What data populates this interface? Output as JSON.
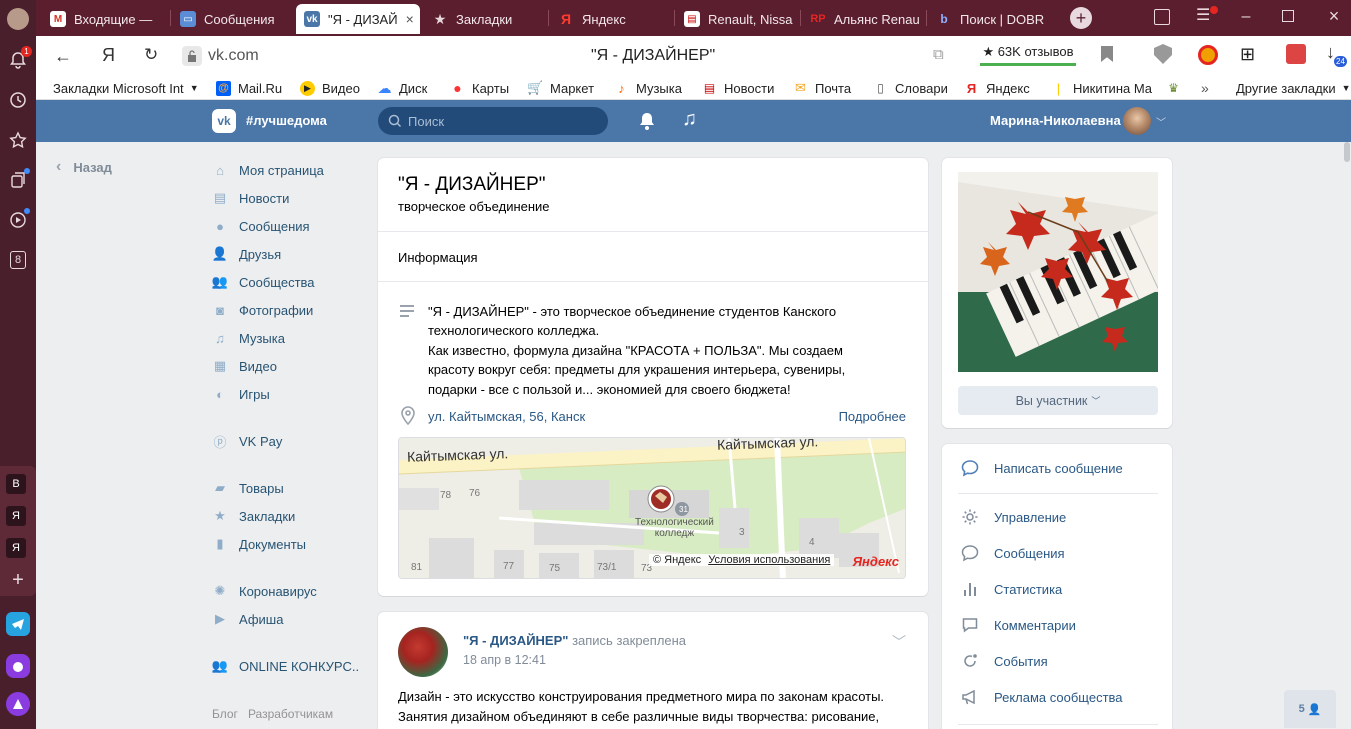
{
  "browser": {
    "tabs": [
      {
        "label": "Входящие — ",
        "icon": "gmail-icon",
        "color": "#d93025"
      },
      {
        "label": "Сообщения",
        "icon": "messages-icon",
        "color": "#5b8dd6"
      },
      {
        "label": "\"Я - ДИЗАЙ",
        "icon": "vk-icon",
        "color": "#4a76a8"
      },
      {
        "label": "Закладки",
        "icon": "star-icon",
        "color": "#e8d9de"
      },
      {
        "label": "Яндекс",
        "icon": "yandex-icon",
        "color": "#e52620"
      },
      {
        "label": "Renault, Nissa",
        "icon": "news-icon",
        "color": "#c00"
      },
      {
        "label": "Альянс Renau",
        "icon": "rp-icon",
        "color": "#c00"
      },
      {
        "label": "Поиск | DOBR",
        "icon": "dobr-icon",
        "color": "#3b5ba5"
      }
    ],
    "address": {
      "domain": "vk.com",
      "page_title": "\"Я - ДИЗАЙНЕР\"",
      "reviews": "★ 63K отзывов"
    },
    "bookmarks": [
      "Закладки Microsoft Int",
      "Mail.Ru",
      "Видео",
      "Диск",
      "Карты",
      "Маркет",
      "Музыка",
      "Новости",
      "Почта",
      "Словари",
      "Яндекс",
      "Никитина Ма",
      "Другие закладки"
    ],
    "sidebar_badge": "1",
    "sidebar_counter": "8",
    "mini_tabs": [
      "В",
      "Я",
      "Я"
    ],
    "download_badge": "24"
  },
  "vk": {
    "header": {
      "logo_text": "#лучшедома",
      "search_placeholder": "Поиск",
      "user_name": "Марина-Николаевна"
    },
    "back": "Назад",
    "menu": [
      {
        "label": "Моя страница",
        "icon": "home-icon"
      },
      {
        "label": "Новости",
        "icon": "news-icon"
      },
      {
        "label": "Сообщения",
        "icon": "chat-icon"
      },
      {
        "label": "Друзья",
        "icon": "friends-icon"
      },
      {
        "label": "Сообщества",
        "icon": "communities-icon"
      },
      {
        "label": "Фотографии",
        "icon": "camera-icon"
      },
      {
        "label": "Музыка",
        "icon": "music-icon"
      },
      {
        "label": "Видео",
        "icon": "video-icon"
      },
      {
        "label": "Игры",
        "icon": "games-icon"
      },
      {
        "label": "VK Pay",
        "icon": "vkpay-icon"
      },
      {
        "label": "Товары",
        "icon": "bag-icon"
      },
      {
        "label": "Закладки",
        "icon": "star-icon"
      },
      {
        "label": "Документы",
        "icon": "doc-icon"
      },
      {
        "label": "Коронавирус",
        "icon": "virus-icon"
      },
      {
        "label": "Афиша",
        "icon": "poster-icon"
      },
      {
        "label": "ONLINE КОНКУРС..",
        "icon": "group-icon"
      }
    ],
    "footer_links": [
      "Блог",
      "Разработчикам"
    ],
    "group": {
      "title": "\"Я - ДИЗАЙНЕР\"",
      "subtitle": "творческое объединение",
      "info_tab": "Информация",
      "description_lines": [
        "\"Я - ДИЗАЙНЕР\" - это творческое объединение студентов Канского",
        "технологического колледжа.",
        "Как известно, формула дизайна \"КРАСОТА + ПОЛЬЗА\". Мы создаем",
        "красоту вокруг себя: предметы для украшения интерьера, сувениры,",
        "подарки - все с пользой и... экономией для своего бюджета!"
      ],
      "address": "ул. Кайтымская, 56, Канск",
      "more": "Подробнее",
      "map": {
        "street1": "Кайтымская ул.",
        "street2": "Кайтымская ул.",
        "college": "Технологический",
        "college2": "колледж",
        "copyright": "© Яндекс",
        "terms": "Условия использования",
        "brand": "Яндекс",
        "numbers": [
          "78",
          "76",
          "77",
          "75",
          "73/1",
          "73",
          "81",
          "3",
          "4"
        ]
      }
    },
    "post": {
      "author": "\"Я - ДИЗАЙНЕР\"",
      "action": "запись закреплена",
      "date": "18 апр в 12:41",
      "text_lines": [
        "Дизайн - это искусство конструирования предметного мира по законам красоты.",
        "Занятия дизайном объединяют в себе различные виды творчества: рисование,"
      ]
    },
    "right": {
      "member_button": "Вы участник",
      "actions": [
        {
          "label": "Написать сообщение",
          "icon": "message-icon"
        },
        {
          "label": "Управление",
          "icon": "gear-icon"
        },
        {
          "label": "Сообщения",
          "icon": "chat-icon"
        },
        {
          "label": "Статистика",
          "icon": "stats-icon"
        },
        {
          "label": "Комментарии",
          "icon": "comment-icon"
        },
        {
          "label": "События",
          "icon": "events-icon"
        },
        {
          "label": "Реклама сообщества",
          "icon": "megaphone-icon"
        }
      ]
    },
    "online_counter": "5"
  }
}
